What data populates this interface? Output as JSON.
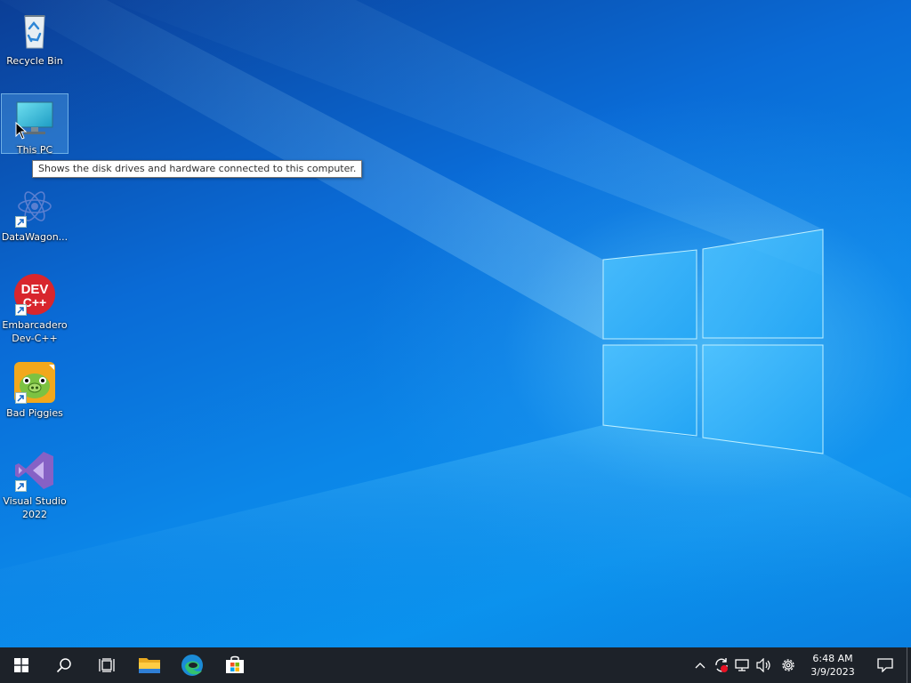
{
  "desktop": {
    "icons": [
      {
        "label": "Recycle Bin",
        "icon": "recycle-bin-icon",
        "shortcut": false,
        "selected": false
      },
      {
        "label": "This PC",
        "icon": "this-pc-icon",
        "shortcut": false,
        "selected": true
      },
      {
        "label": "DataWagon...",
        "icon": "datawagon-icon",
        "shortcut": true,
        "selected": false
      },
      {
        "label": "Embarcadero\nDev-C++",
        "icon": "devcpp-icon",
        "shortcut": true,
        "selected": false
      },
      {
        "label": "Bad Piggies",
        "icon": "bad-piggies-icon",
        "shortcut": true,
        "selected": false
      },
      {
        "label": "Visual Studio\n2022",
        "icon": "visual-studio-icon",
        "shortcut": true,
        "selected": false
      }
    ],
    "tooltip": "Shows the disk drives and hardware connected to this computer."
  },
  "devcpp_icon_text": {
    "line1": "DEV",
    "line2": "C++"
  },
  "taskbar": {
    "left": [
      {
        "name": "start-button",
        "icon": "windows-logo-icon"
      },
      {
        "name": "search-button",
        "icon": "search-icon"
      },
      {
        "name": "task-view-button",
        "icon": "task-view-icon"
      }
    ],
    "apps": [
      {
        "name": "file-explorer",
        "icon": "folder-icon"
      },
      {
        "name": "microsoft-edge",
        "icon": "edge-icon"
      },
      {
        "name": "microsoft-store",
        "icon": "store-icon"
      }
    ],
    "tray": {
      "icons": [
        "chevron-up-icon",
        "sync-error-icon",
        "network-icon",
        "volume-icon",
        "settings-icon"
      ],
      "time": "6:48 AM",
      "date": "3/9/2023",
      "notification_icon": "action-center-icon"
    }
  },
  "colors": {
    "taskbar_bg": "#1d2229",
    "desktop_accent": "#0a7fe0",
    "devcpp_red": "#d8262d"
  }
}
